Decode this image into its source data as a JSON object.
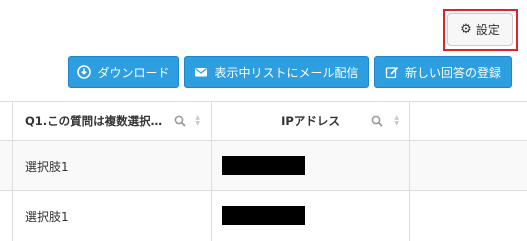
{
  "toolbar": {
    "settings_label": "設定",
    "download_label": "ダウンロード",
    "mail_label": "表示中リストにメール配信",
    "register_label": "新しい回答の登録"
  },
  "table": {
    "columns": [
      {
        "label": "Q1.この質問は複数選択…"
      },
      {
        "label": "IPアドレス"
      }
    ],
    "rows": [
      {
        "q1": "選択肢1",
        "ip": "[redacted]"
      },
      {
        "q1": "選択肢1",
        "ip": "[redacted]"
      }
    ]
  },
  "colors": {
    "primary_button": "#2d9ee0",
    "highlight": "#e0222b"
  },
  "icons": [
    "gear-icon",
    "download-icon",
    "mail-icon",
    "edit-icon",
    "search-icon",
    "sort-icon"
  ]
}
